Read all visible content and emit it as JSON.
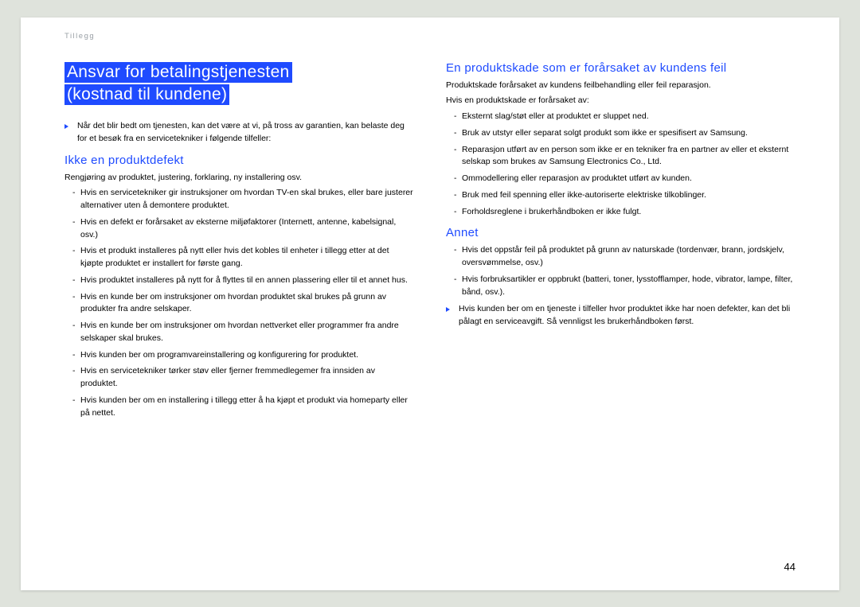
{
  "breadcrumb": "Tillegg",
  "page_number": "44",
  "left": {
    "title_line1": "Ansvar for betalingstjenesten",
    "title_line2": "(kostnad til kundene)",
    "note1": "Når det blir bedt om tjenesten, kan det være at vi, på tross av garantien, kan belaste deg for et besøk fra en servicetekniker i følgende tilfeller:",
    "sub1_title": "Ikke en produktdefekt",
    "sub1_intro": "Rengjøring av produktet, justering, forklaring, ny installering osv.",
    "sub1_items": [
      "Hvis en servicetekniker gir instruksjoner om hvordan TV-en skal brukes, eller bare justerer alternativer uten å demontere produktet.",
      "Hvis en defekt er forårsaket av eksterne miljøfaktorer (Internett, antenne, kabelsignal, osv.)",
      "Hvis et produkt installeres på nytt eller hvis det kobles til enheter i tillegg etter at det kjøpte produktet er installert for første gang.",
      "Hvis produktet installeres på nytt for å flyttes til en annen plassering eller til et annet hus.",
      "Hvis en kunde ber om instruksjoner om hvordan produktet skal brukes på grunn av produkter fra andre selskaper.",
      "Hvis en kunde ber om instruksjoner om hvordan nettverket eller programmer fra andre selskaper skal brukes.",
      "Hvis kunden ber om programvareinstallering og konfigurering for produktet.",
      "Hvis en servicetekniker tørker støv eller fjerner fremmedlegemer fra innsiden av produktet.",
      "Hvis kunden ber om en installering i tillegg etter å ha kjøpt et produkt via homeparty eller på nettet."
    ]
  },
  "right": {
    "sub1_title": "En produktskade som er forårsaket av kundens feil",
    "sub1_intro1": "Produktskade forårsaket av kundens feilbehandling eller feil reparasjon.",
    "sub1_intro2": "Hvis en produktskade er forårsaket av:",
    "sub1_items": [
      "Eksternt slag/støt eller at produktet er sluppet ned.",
      "Bruk av utstyr eller separat solgt produkt som ikke er spesifisert av Samsung.",
      "Reparasjon utført av en person som ikke er en tekniker fra en partner av eller et eksternt selskap som brukes av Samsung Electronics Co., Ltd.",
      "Ommodellering eller reparasjon av produktet utført av kunden.",
      "Bruk med feil spenning eller ikke-autoriserte elektriske tilkoblinger.",
      "Forholdsreglene i brukerhåndboken er ikke fulgt."
    ],
    "sub2_title": "Annet",
    "sub2_items": [
      "Hvis det oppstår feil på produktet på grunn av naturskade (tordenvær, brann, jordskjelv, oversvømmelse, osv.)",
      "Hvis forbruksartikler er oppbrukt (batteri, toner, lysstofflamper, hode, vibrator, lampe, filter, bånd, osv.)."
    ],
    "note2": "Hvis kunden ber om en tjeneste i tilfeller hvor produktet ikke har noen defekter, kan det bli pålagt en serviceavgift. Så vennligst les brukerhåndboken først."
  }
}
